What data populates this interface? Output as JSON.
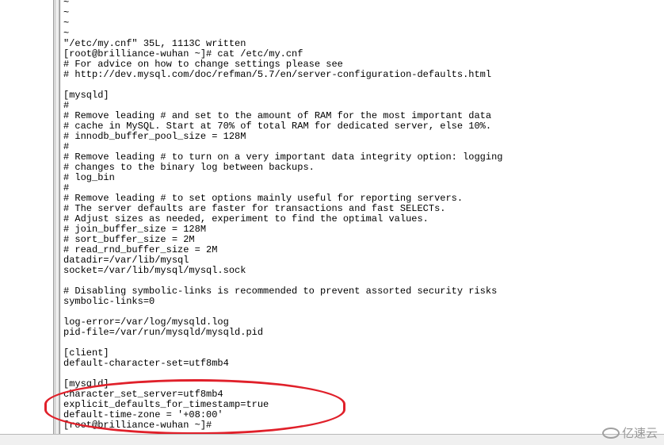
{
  "terminal": {
    "lines": [
      "~",
      "~",
      "~",
      "~",
      "\"/etc/my.cnf\" 35L, 1113C written",
      "[root@brilliance-wuhan ~]# cat /etc/my.cnf",
      "# For advice on how to change settings please see",
      "# http://dev.mysql.com/doc/refman/5.7/en/server-configuration-defaults.html",
      "",
      "[mysqld]",
      "#",
      "# Remove leading # and set to the amount of RAM for the most important data",
      "# cache in MySQL. Start at 70% of total RAM for dedicated server, else 10%.",
      "# innodb_buffer_pool_size = 128M",
      "#",
      "# Remove leading # to turn on a very important data integrity option: logging",
      "# changes to the binary log between backups.",
      "# log_bin",
      "#",
      "# Remove leading # to set options mainly useful for reporting servers.",
      "# The server defaults are faster for transactions and fast SELECTs.",
      "# Adjust sizes as needed, experiment to find the optimal values.",
      "# join_buffer_size = 128M",
      "# sort_buffer_size = 2M",
      "# read_rnd_buffer_size = 2M",
      "datadir=/var/lib/mysql",
      "socket=/var/lib/mysql/mysql.sock",
      "",
      "# Disabling symbolic-links is recommended to prevent assorted security risks",
      "symbolic-links=0",
      "",
      "log-error=/var/log/mysqld.log",
      "pid-file=/var/run/mysqld/mysqld.pid",
      "",
      "[client]",
      "default-character-set=utf8mb4",
      "",
      "[mysqld]",
      "character_set_server=utf8mb4",
      "explicit_defaults_for_timestamp=true",
      "default-time-zone = '+08:00'",
      "[root@brilliance-wuhan ~]#"
    ]
  },
  "annotation": {
    "color": "#e0202a"
  },
  "watermark": {
    "text": "亿速云",
    "icon": "yisu-cloud-logo-icon"
  }
}
